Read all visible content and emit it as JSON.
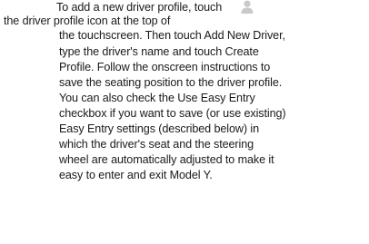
{
  "document": {
    "lines": [
      "To add a new driver profile, touch",
      "the driver profile icon at the top of",
      "the touchscreen. Then touch Add New Driver,",
      "type the driver's name and touch Create",
      "Profile. Follow the onscreen instructions to",
      "save the seating position to the driver profile.",
      "You can also check the Use Easy Entry",
      "checkbox if you want to save (or use existing)",
      "Easy Entry settings (described below) in",
      "which the driver's seat and the steering",
      "wheel are automatically adjusted to make it",
      "easy to enter and exit Model Y."
    ],
    "icons": {
      "inline_profile_icon": "driver-profile-icon"
    }
  }
}
